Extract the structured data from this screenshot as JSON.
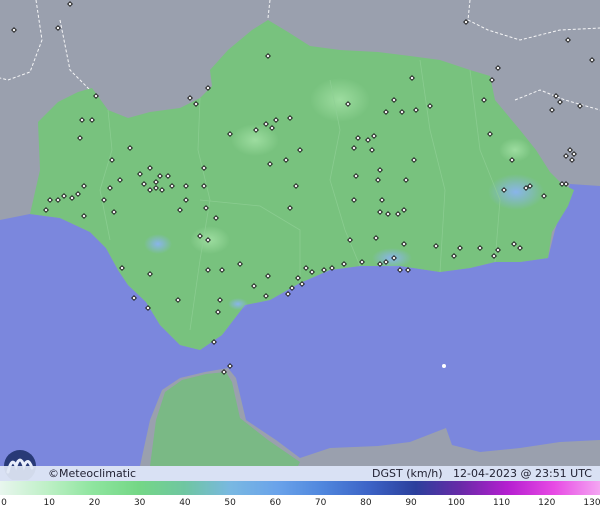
{
  "brand": {
    "copyright_symbol": "©",
    "name": "Meteoclimatic"
  },
  "map_info": {
    "variable": "DGST",
    "unit": "(km/h)",
    "date": "12-04-2023",
    "at": "@",
    "time": "23:51 UTC"
  },
  "legend": {
    "ticks": [
      "0",
      "10",
      "20",
      "30",
      "40",
      "50",
      "60",
      "70",
      "80",
      "90",
      "100",
      "110",
      "120",
      "130"
    ],
    "tick_values": [
      0,
      10,
      20,
      30,
      40,
      50,
      60,
      70,
      80,
      90,
      100,
      110,
      120,
      130
    ],
    "range": [
      0,
      130
    ],
    "colors": [
      "#e8f6ee",
      "#bff0c7",
      "#8fe59f",
      "#74d786",
      "#6fc6a1",
      "#79b8e2",
      "#6aa3ea",
      "#4f86dd",
      "#3c63c6",
      "#2b3f9c",
      "#6a2aa8",
      "#b51fd0",
      "#e74ae4",
      "#f4a6f2"
    ]
  },
  "colors": {
    "sea": "#7b87dd",
    "land_andalucia": "#78c27e",
    "land_outside": "#9aa0ae",
    "station_marker": "#111111"
  }
}
